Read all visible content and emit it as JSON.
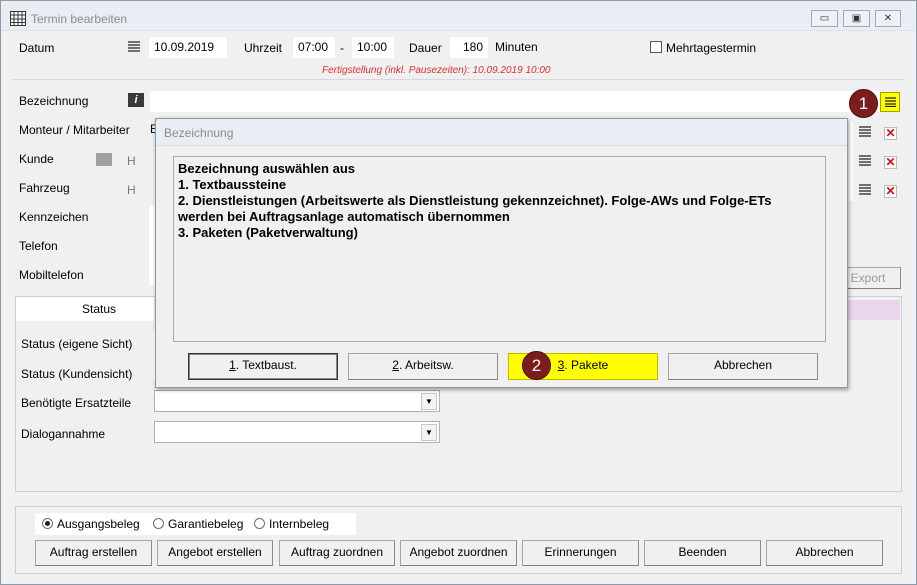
{
  "window": {
    "title": "Termin bearbeiten"
  },
  "header": {
    "datum_label": "Datum",
    "datum_value": "10.09.2019",
    "uhrzeit_label": "Uhrzeit",
    "time_from": "07:00",
    "time_sep": "-",
    "time_to": "10:00",
    "dauer_label": "Dauer",
    "dauer_value": "180",
    "minuten_label": "Minuten",
    "mehrtages_label": "Mehrtagestermin",
    "fertigstellung": "Fertigstellung (inkl. Pausezeiten): 10.09.2019 10:00"
  },
  "fields": {
    "bezeichnung": "Bezeichnung",
    "monteur": "Monteur / Mitarbeiter",
    "kunde": "Kunde",
    "fahrzeug": "Fahrzeug",
    "kennzeichen": "Kennzeichen",
    "telefon": "Telefon",
    "mobiltelefon": "Mobiltelefon",
    "h_marker": "H",
    "export_label": "Export"
  },
  "status": {
    "header": "Status",
    "eigene": "Status (eigene Sicht)",
    "kunden": "Status (Kundensicht)",
    "ersatzteile": "Benötigte Ersatzteile",
    "dialog": "Dialogannahme"
  },
  "radios": {
    "ausgang": "Ausgangsbeleg",
    "garantie": "Garantiebeleg",
    "intern": "Internbeleg"
  },
  "bottom_buttons": {
    "auftrag_erstellen": "Auftrag erstellen",
    "angebot_erstellen": "Angebot erstellen",
    "auftrag_zuordnen": "Auftrag zuordnen",
    "angebot_zuordnen": "Angebot zuordnen",
    "erinnerungen": "Erinnerungen",
    "beenden": "Beenden",
    "abbrechen": "Abbrechen"
  },
  "dialog": {
    "title": "Bezeichnung",
    "text": [
      "Bezeichnung auswählen aus",
      "1. Textbaussteine",
      "2. Dienstleistungen (Arbeitswerte als Dienstleistung gekennzeichnet). Folge-AWs und Folge-ETs",
      "werden bei Auftragsanlage automatisch übernommen",
      "3. Paketen (Paketverwaltung)"
    ],
    "btn1_num": "1",
    "btn1_rest": ". Textbaust.",
    "btn2_num": "2",
    "btn2_rest": ". Arbeitsw.",
    "btn3_num": "3",
    "btn3_rest": ". Pakete",
    "btn4": "Abbrechen"
  },
  "callouts": {
    "one": "1",
    "two": "2"
  },
  "colors": {
    "highlight": "#ffff00",
    "callout": "#7b1d1d",
    "fertig": "#e03030",
    "status_band": "#e9d6ea"
  }
}
